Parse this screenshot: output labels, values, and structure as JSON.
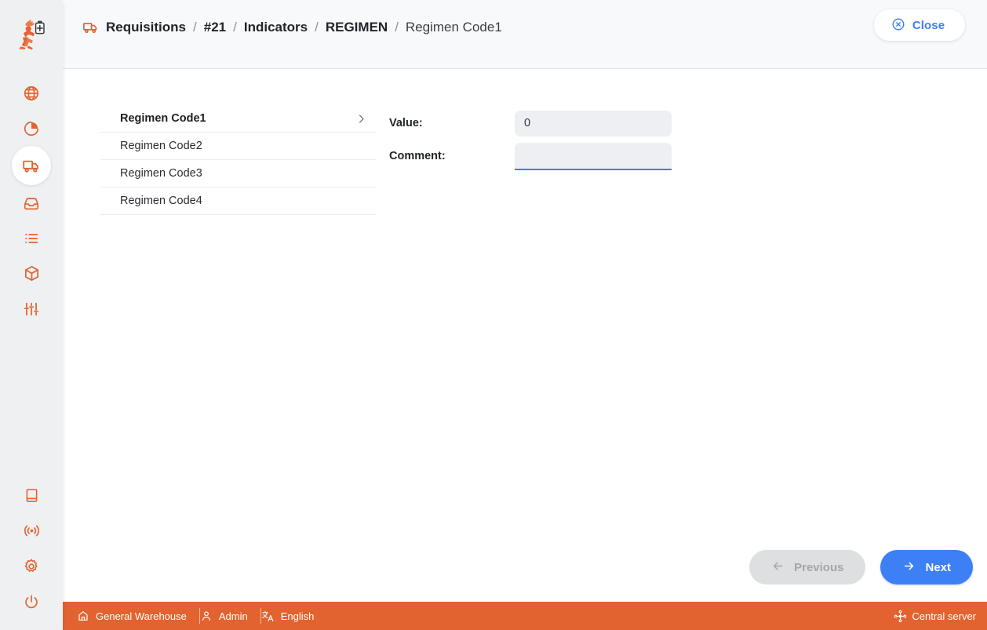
{
  "app": {
    "logo_name": "msupply-runner-logo"
  },
  "sidebar": {
    "top_items": [
      {
        "name": "globe-icon",
        "label": "Dashboard",
        "active": false
      },
      {
        "name": "pie-chart-icon",
        "label": "Reports",
        "active": false
      },
      {
        "name": "truck-icon",
        "label": "Requisitions",
        "active": true
      },
      {
        "name": "inbox-icon",
        "label": "Inbound",
        "active": false
      },
      {
        "name": "list-icon",
        "label": "Lists",
        "active": false
      },
      {
        "name": "package-icon",
        "label": "Stock",
        "active": false
      },
      {
        "name": "sliders-icon",
        "label": "Tools",
        "active": false
      }
    ],
    "bottom_items": [
      {
        "name": "book-icon",
        "label": "Manual"
      },
      {
        "name": "broadcast-icon",
        "label": "Sync"
      },
      {
        "name": "gear-icon",
        "label": "Settings"
      },
      {
        "name": "power-icon",
        "label": "Logout"
      }
    ]
  },
  "header": {
    "breadcrumb_icon": "truck-icon",
    "breadcrumb": [
      {
        "label": "Requisitions",
        "bold": true
      },
      {
        "label": "#21",
        "bold": true
      },
      {
        "label": "Indicators",
        "bold": true
      },
      {
        "label": "REGIMEN",
        "bold": true
      },
      {
        "label": "Regimen Code1",
        "bold": false
      }
    ],
    "separator": "/",
    "close_label": "Close",
    "close_icon": "close-circle-icon"
  },
  "indicators": {
    "items": [
      {
        "label": "Regimen Code1",
        "selected": true
      },
      {
        "label": "Regimen Code2",
        "selected": false
      },
      {
        "label": "Regimen Code3",
        "selected": false
      },
      {
        "label": "Regimen Code4",
        "selected": false
      }
    ],
    "chevron_icon": "chevron-right-icon"
  },
  "form": {
    "value_label": "Value:",
    "value": "0",
    "value_placeholder": "",
    "comment_label": "Comment:",
    "comment": "",
    "comment_placeholder": ""
  },
  "wizard": {
    "previous_label": "Previous",
    "previous_icon": "arrow-left-icon",
    "previous_disabled": true,
    "next_label": "Next",
    "next_icon": "arrow-right-icon"
  },
  "statusbar": {
    "store": "General Warehouse",
    "store_icon": "home-icon",
    "user": "Admin",
    "user_icon": "person-icon",
    "language": "English",
    "language_icon": "translate-icon",
    "server": "Central server",
    "server_icon": "hub-icon"
  },
  "colors": {
    "brand_orange": "#e2632f",
    "accent_blue": "#3d7ff4",
    "sidebar_bg": "#eff0f2",
    "header_bg": "#f8f9fb",
    "field_bg": "#eeeff2"
  }
}
